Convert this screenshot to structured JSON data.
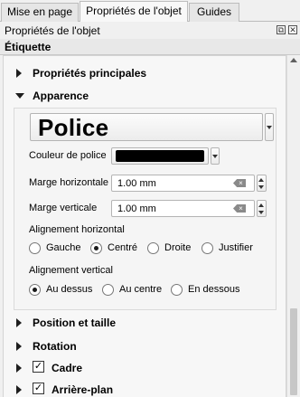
{
  "tabs": [
    {
      "label": "Mise en page",
      "active": false
    },
    {
      "label": "Propriétés de l'objet",
      "active": true
    },
    {
      "label": "Guides",
      "active": false
    }
  ],
  "dock": {
    "title": "Propriétés de l'objet",
    "float_glyph": "⧉",
    "close_glyph": "✕"
  },
  "item": {
    "title": "Étiquette"
  },
  "sections": {
    "main_props": {
      "label": "Propriétés principales",
      "expanded": false
    },
    "appearance": {
      "label": "Apparence",
      "expanded": true
    },
    "position_size": {
      "label": "Position et taille",
      "expanded": false
    },
    "rotation": {
      "label": "Rotation",
      "expanded": false
    },
    "frame": {
      "label": "Cadre",
      "expanded": false,
      "checked": true
    },
    "background": {
      "label": "Arrière-plan",
      "expanded": false,
      "checked": true
    }
  },
  "appearance": {
    "font_button": "Police",
    "font_color_label": "Couleur de police",
    "font_color": "#000000",
    "h_margin_label": "Marge horizontale",
    "h_margin_value": "1.00 mm",
    "v_margin_label": "Marge verticale",
    "v_margin_value": "1.00 mm",
    "h_align_label": "Alignement horizontal",
    "h_align_options": [
      "Gauche",
      "Centré",
      "Droite",
      "Justifier"
    ],
    "h_align_selected": "Centré",
    "v_align_label": "Alignement vertical",
    "v_align_options": [
      "Au dessus",
      "Au centre",
      "En dessous"
    ],
    "v_align_selected": "Au dessus"
  },
  "checkbox_glyph": "✓"
}
